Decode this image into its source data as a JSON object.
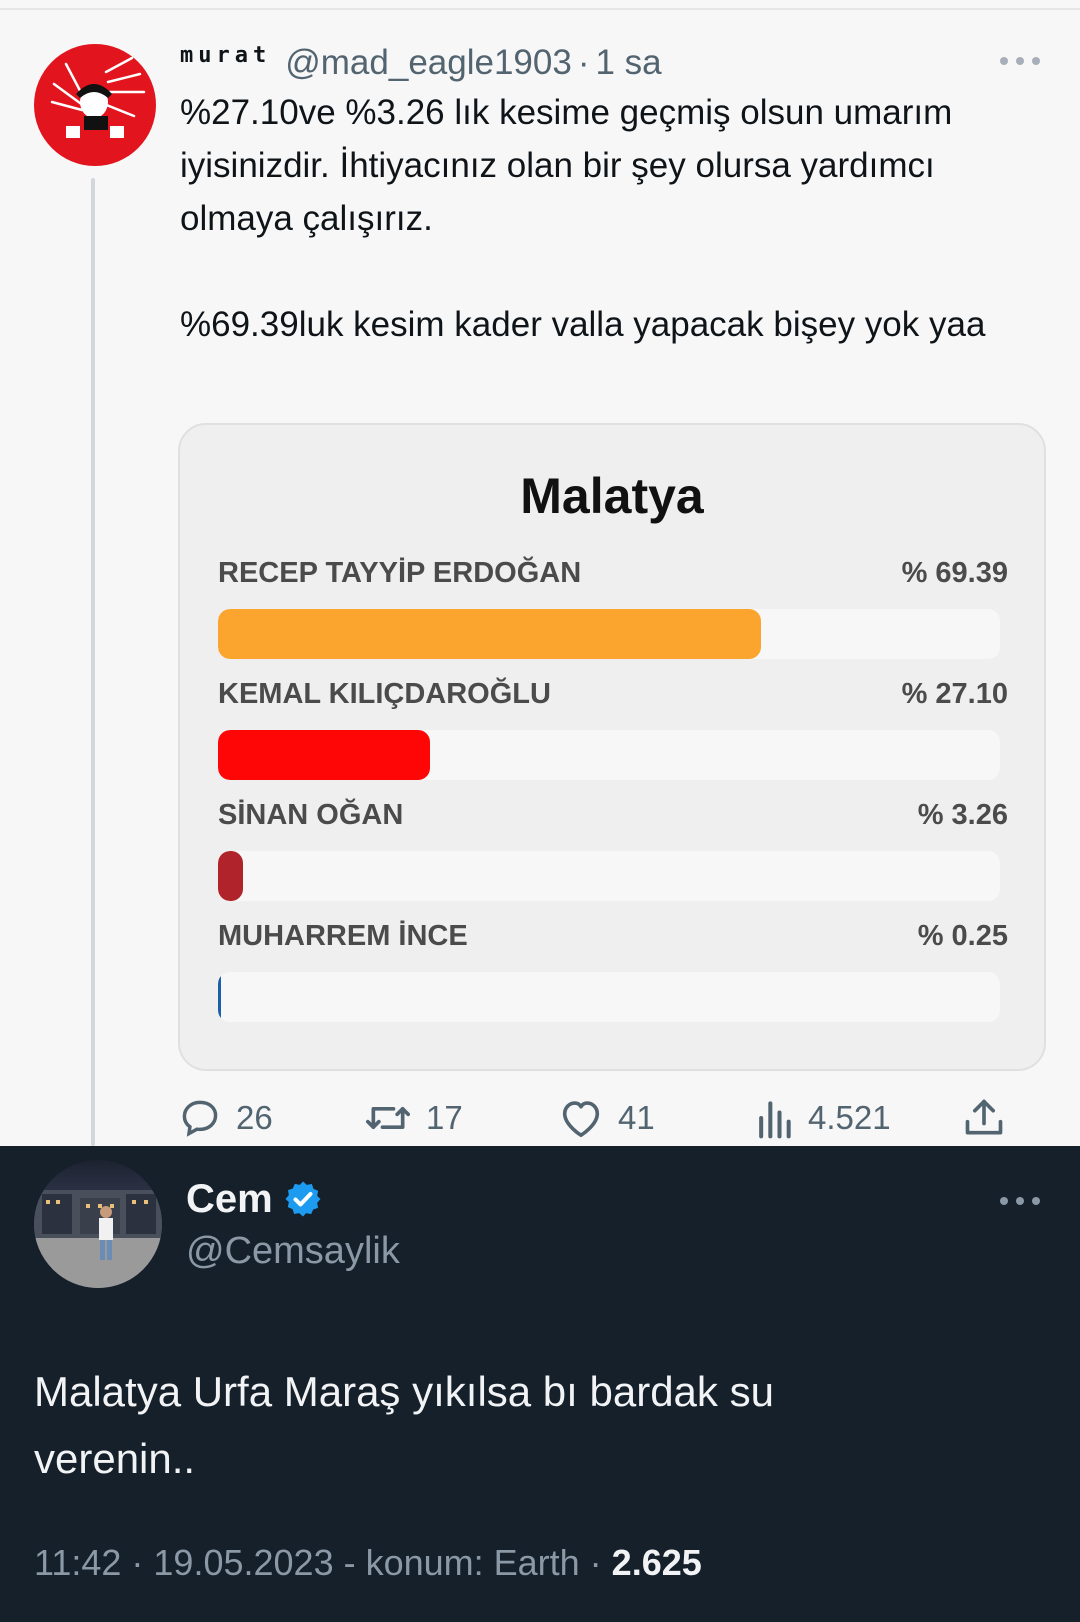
{
  "tweet1": {
    "display_name": "murat",
    "handle": "@mad_eagle1903",
    "separator": "·",
    "time": "1 sa",
    "text": "%27.10ve %3.26 lık kesime geçmiş olsun umarım iyisinizdir. İhtiyacınız olan bir şey olursa yardımcı olmaya çalışırız.\n\n%69.39luk kesim kader valla yapacak bişey yok yaa",
    "card": {
      "title": "Malatya",
      "candidates": [
        {
          "name": "RECEP TAYYİP ERDOĞAN",
          "percent_label": "% 69.39",
          "value": 69.39,
          "color": "#fca52e"
        },
        {
          "name": "KEMAL KILIÇDAROĞLU",
          "percent_label": "% 27.10",
          "value": 27.1,
          "color": "#fe0606"
        },
        {
          "name": "SİNAN OĞAN",
          "percent_label": "% 3.26",
          "value": 3.26,
          "color": "#b0232a"
        },
        {
          "name": "MUHARREM İNCE",
          "percent_label": "% 0.25",
          "value": 0.25,
          "color": "#1a5fa8"
        }
      ]
    },
    "actions": {
      "replies": "26",
      "retweets": "17",
      "likes": "41",
      "views": "4.521"
    }
  },
  "tweet2": {
    "display_name": "Cem",
    "handle": "@Cemsaylik",
    "text": "Malatya Urfa  Maraş yıkılsa bı bardak su\nverenin..",
    "meta": "11:42 · 19.05.2023 - konum: Earth · ",
    "views": "2.625"
  }
}
